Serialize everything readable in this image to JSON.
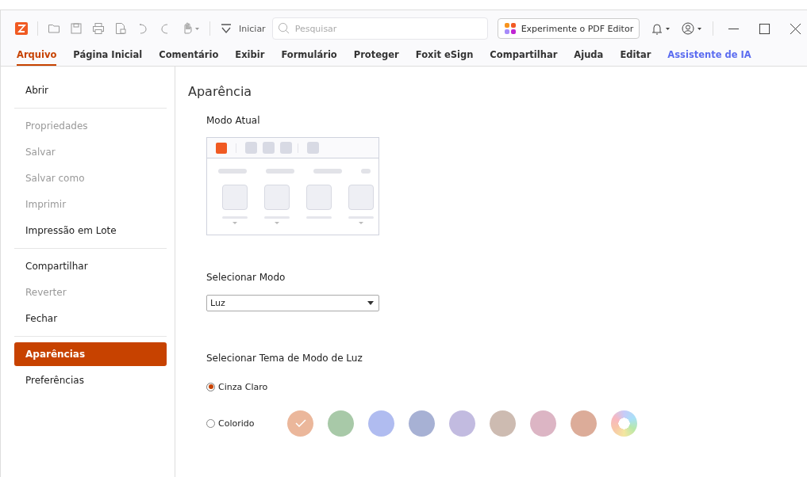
{
  "toolbar": {
    "start_label": "Iniciar",
    "search": {
      "placeholder": "Pesquisar"
    },
    "promo_button": "Experimente o PDF Editor"
  },
  "tabs": [
    {
      "label": "Arquivo",
      "selected": true,
      "kind": "normal"
    },
    {
      "label": "Página Inicial",
      "selected": false,
      "kind": "normal"
    },
    {
      "label": "Comentário",
      "selected": false,
      "kind": "normal"
    },
    {
      "label": "Exibir",
      "selected": false,
      "kind": "normal"
    },
    {
      "label": "Formulário",
      "selected": false,
      "kind": "normal"
    },
    {
      "label": "Proteger",
      "selected": false,
      "kind": "normal"
    },
    {
      "label": "Foxit eSign",
      "selected": false,
      "kind": "normal"
    },
    {
      "label": "Compartilhar",
      "selected": false,
      "kind": "normal"
    },
    {
      "label": "Ajuda",
      "selected": false,
      "kind": "normal"
    },
    {
      "label": "Editar",
      "selected": false,
      "kind": "normal"
    },
    {
      "label": "Assistente de IA",
      "selected": false,
      "kind": "ai"
    }
  ],
  "sidebar": {
    "groups": [
      [
        {
          "label": "Abrir",
          "disabled": false,
          "selected": false
        }
      ],
      [
        {
          "label": "Propriedades",
          "disabled": true,
          "selected": false
        },
        {
          "label": "Salvar",
          "disabled": true,
          "selected": false
        },
        {
          "label": "Salvar como",
          "disabled": true,
          "selected": false
        },
        {
          "label": "Imprimir",
          "disabled": true,
          "selected": false
        },
        {
          "label": "Impressão em Lote",
          "disabled": false,
          "selected": false
        }
      ],
      [
        {
          "label": "Compartilhar",
          "disabled": false,
          "selected": false
        },
        {
          "label": "Reverter",
          "disabled": true,
          "selected": false
        },
        {
          "label": "Fechar",
          "disabled": false,
          "selected": false
        }
      ],
      [
        {
          "label": "Aparências",
          "disabled": false,
          "selected": true
        },
        {
          "label": "Preferências",
          "disabled": false,
          "selected": false
        }
      ]
    ]
  },
  "content": {
    "title": "Aparência",
    "current_mode_label": "Modo Atual",
    "select_mode_label": "Selecionar Modo",
    "mode_value": "Luz",
    "theme_label": "Selecionar Tema de Modo de Luz",
    "themes": [
      {
        "label": "Cinza Claro",
        "selected": true
      },
      {
        "label": "Colorido",
        "selected": false
      }
    ],
    "swatches": [
      {
        "kind": "solid",
        "color": "#ebb79b",
        "selected": true
      },
      {
        "kind": "solid",
        "color": "#a8c9a8",
        "selected": false
      },
      {
        "kind": "solid",
        "color": "#b0bcf0",
        "selected": false
      },
      {
        "kind": "solid",
        "color": "#a7b1d4",
        "selected": false
      },
      {
        "kind": "solid",
        "color": "#c2bbe0",
        "selected": false
      },
      {
        "kind": "solid",
        "color": "#cdbbb1",
        "selected": false
      },
      {
        "kind": "solid",
        "color": "#dcb5c4",
        "selected": false
      },
      {
        "kind": "solid",
        "color": "#dcac99",
        "selected": false
      },
      {
        "kind": "rainbow",
        "selected": false
      }
    ]
  }
}
